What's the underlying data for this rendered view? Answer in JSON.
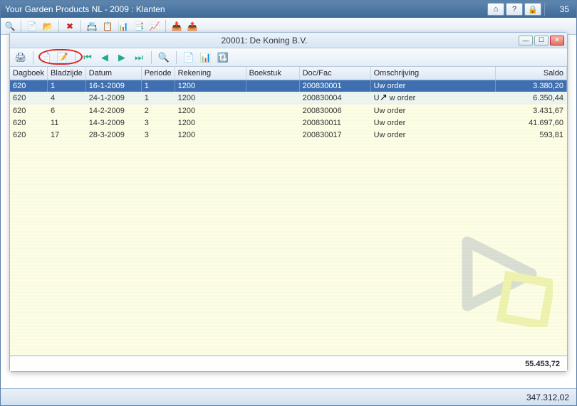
{
  "app_title": "Your Garden Products NL - 2009 : Klanten",
  "counter": "35",
  "inner_title": "20001: De Koning B.V.",
  "columns": {
    "c0": "Dagboek",
    "c1": "Bladzijde",
    "c2": "Datum",
    "c3": "Periode",
    "c4": "Rekening",
    "c5": "Boekstuk",
    "c6": "Doc/Fac",
    "c7": "Omschrijving",
    "c8": "Saldo"
  },
  "rows": [
    {
      "c0": "620",
      "c1": "1",
      "c2": "16-1-2009",
      "c3": "1",
      "c4": "1200",
      "c5": "",
      "c6": "200830001",
      "c7": "Uw order",
      "c8": "3.380,20",
      "selected": true
    },
    {
      "c0": "620",
      "c1": "4",
      "c2": "24-1-2009",
      "c3": "1",
      "c4": "1200",
      "c5": "",
      "c6": "200830004",
      "c7": "Uw order",
      "c8": "6.350,44",
      "alt": true,
      "cursor": true
    },
    {
      "c0": "620",
      "c1": "6",
      "c2": "14-2-2009",
      "c3": "2",
      "c4": "1200",
      "c5": "",
      "c6": "200830006",
      "c7": "Uw order",
      "c8": "3.431,67"
    },
    {
      "c0": "620",
      "c1": "11",
      "c2": "14-3-2009",
      "c3": "3",
      "c4": "1200",
      "c5": "",
      "c6": "200830011",
      "c7": "Uw order",
      "c8": "41.697,60"
    },
    {
      "c0": "620",
      "c1": "17",
      "c2": "28-3-2009",
      "c3": "3",
      "c4": "1200",
      "c5": "",
      "c6": "200830017",
      "c7": "Uw order",
      "c8": "593,81"
    }
  ],
  "sum": "55.453,72",
  "status_total": "347.312,02"
}
